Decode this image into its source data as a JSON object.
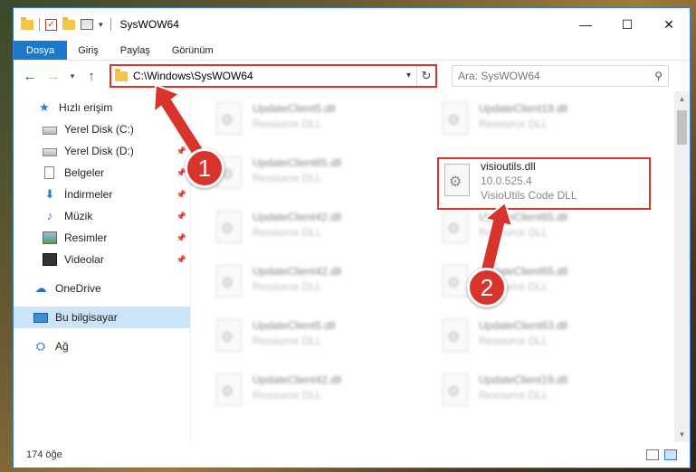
{
  "window": {
    "title": "SysWOW64"
  },
  "window_controls": {
    "minimize": "—",
    "maximize": "☐",
    "close": "✕"
  },
  "menu": [
    "Dosya",
    "Giriş",
    "Paylaş",
    "Görünüm"
  ],
  "address": {
    "path": "C:\\Windows\\SysWOW64"
  },
  "search": {
    "placeholder": "Ara: SysWOW64"
  },
  "nav": {
    "quick_access": "Hızlı erişim",
    "items": [
      "Yerel Disk (C:)",
      "Yerel Disk (D:)",
      "Belgeler",
      "İndirmeler",
      "Müzik",
      "Resimler",
      "Videolar"
    ],
    "onedrive": "OneDrive",
    "this_pc": "Bu bilgisayar",
    "network": "Ağ"
  },
  "files": [
    {
      "name": "UpdateClient5.dll",
      "desc": "Resource DLL"
    },
    {
      "name": "UpdateClient19.dll",
      "desc": "Resource DLL"
    },
    {
      "name": "UpdateClient65.dll",
      "desc": "Resource DLL"
    },
    {
      "name": "visioutils.dll",
      "version": "10.0.525.4",
      "desc": "VisioUtils Code DLL"
    },
    {
      "name": "UpdateClient42.dll",
      "desc": "Resource DLL"
    },
    {
      "name": "UpdateClient65.dll",
      "desc": "Resource DLL"
    },
    {
      "name": "UpdateClient42.dll",
      "desc": "Resource DLL"
    },
    {
      "name": "UpdateClient65.dll",
      "desc": "Resource DLL"
    },
    {
      "name": "UpdateClient5.dll",
      "desc": "Resource DLL"
    },
    {
      "name": "UpdateClient63.dll",
      "desc": "Resource DLL"
    },
    {
      "name": "UpdateClient42.dll",
      "desc": "Resource DLL"
    },
    {
      "name": "UpdateClient19.dll",
      "desc": "Resource DLL"
    }
  ],
  "status": {
    "count": "174 öğe"
  },
  "badges": {
    "one": "1",
    "two": "2"
  },
  "colors": {
    "accent": "#1979ca",
    "highlight": "#d9342b"
  }
}
